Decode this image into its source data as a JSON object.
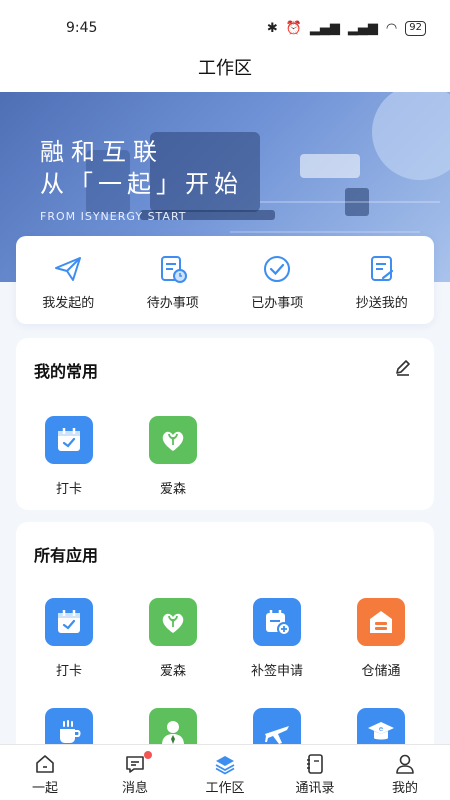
{
  "status": {
    "time": "9:45",
    "battery": "92"
  },
  "header": {
    "title": "工作区"
  },
  "banner": {
    "line1": "融和互联",
    "line2": "从「一起」开始",
    "subtitle": "FROM ISYNERGY START"
  },
  "quick": [
    {
      "label": "我发起的",
      "icon": "paper-plane-icon"
    },
    {
      "label": "待办事项",
      "icon": "todo-list-icon"
    },
    {
      "label": "已办事项",
      "icon": "check-circle-icon"
    },
    {
      "label": "抄送我的",
      "icon": "cc-doc-icon"
    }
  ],
  "common": {
    "title": "我的常用",
    "apps": [
      {
        "label": "打卡",
        "icon": "calendar-check-icon",
        "color": "#3d8ef0"
      },
      {
        "label": "爱森",
        "icon": "heart-leaf-icon",
        "color": "#5dc05d"
      }
    ]
  },
  "all": {
    "title": "所有应用",
    "apps": [
      {
        "label": "打卡",
        "icon": "calendar-check-icon",
        "color": "#3d8ef0"
      },
      {
        "label": "爱森",
        "icon": "heart-leaf-icon",
        "color": "#5dc05d"
      },
      {
        "label": "补签申请",
        "icon": "calendar-plus-icon",
        "color": "#3d8ef0"
      },
      {
        "label": "仓储通",
        "icon": "warehouse-icon",
        "color": "#f47b3c"
      },
      {
        "label": "",
        "icon": "coffee-cup-icon",
        "color": "#3d8ef0"
      },
      {
        "label": "",
        "icon": "person-icon",
        "color": "#5dc05d"
      },
      {
        "label": "",
        "icon": "airplane-icon",
        "color": "#3d8ef0"
      },
      {
        "label": "",
        "icon": "graduation-icon",
        "color": "#3d8ef0"
      }
    ]
  },
  "tabs": [
    {
      "label": "一起",
      "icon": "home-icon"
    },
    {
      "label": "消息",
      "icon": "message-icon"
    },
    {
      "label": "工作区",
      "icon": "layers-icon"
    },
    {
      "label": "通讯录",
      "icon": "contacts-icon"
    },
    {
      "label": "我的",
      "icon": "user-icon"
    }
  ],
  "colors": {
    "accent": "#3d8ef0",
    "green": "#5dc05d",
    "orange": "#f47b3c",
    "badge": "#f25555"
  }
}
